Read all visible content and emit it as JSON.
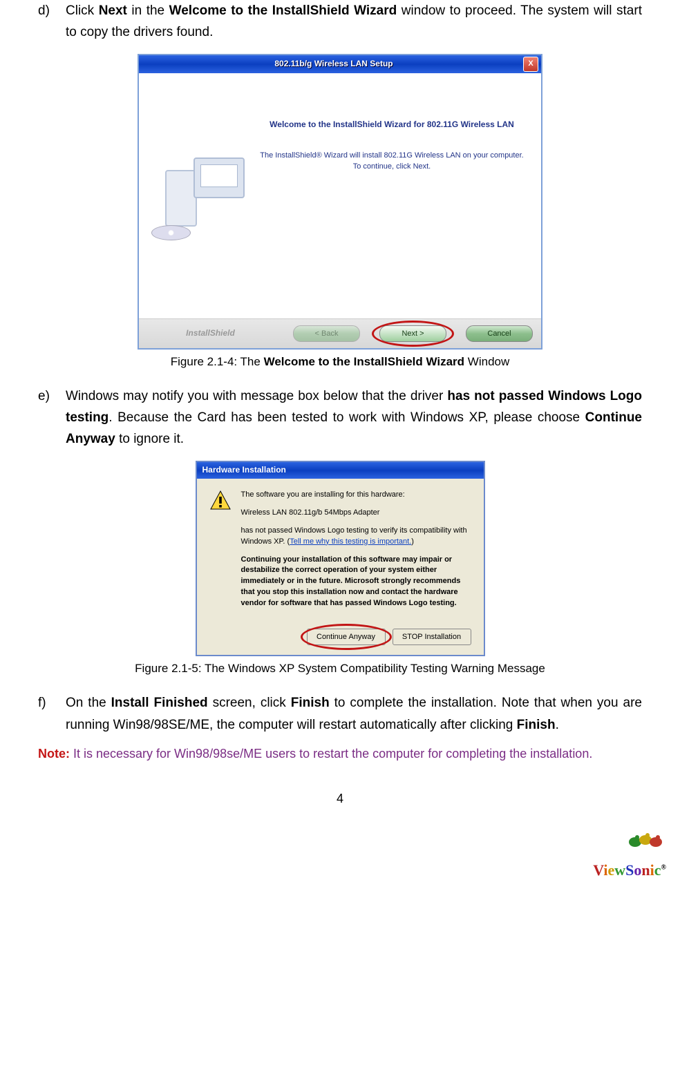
{
  "step_d": {
    "marker": "d)",
    "t1": "Click ",
    "b1": "Next",
    "t2": " in the ",
    "b2": "Welcome to the InstallShield Wizard",
    "t3": " window to proceed. The system will start to copy the drivers found."
  },
  "installer": {
    "title": "802.11b/g Wireless LAN Setup",
    "close": "X",
    "heading": "Welcome to the InstallShield Wizard for 802.11G Wireless LAN",
    "desc": "The InstallShield® Wizard will install 802.11G Wireless LAN on your computer.  To continue, click Next.",
    "brand": "InstallShield",
    "back": "< Back",
    "next": "Next >",
    "cancel": "Cancel"
  },
  "fig1_caption_pre": "Figure 2.1-4: The ",
  "fig1_caption_bold": "Welcome to the InstallShield Wizard",
  "fig1_caption_post": " Window",
  "step_e": {
    "marker": "e)",
    "t1": "Windows may notify you with message box below that the driver ",
    "b1": "has not passed Windows Logo testing",
    "t2": ". Because the Card has been tested to work with Windows XP, please choose ",
    "b2": "Continue Anyway",
    "t3": " to ignore it."
  },
  "hw": {
    "title": "Hardware Installation",
    "line1": "The software you are installing for this hardware:",
    "device": "Wireless LAN 802.11g/b 54Mbps Adapter",
    "line2a": "has not passed Windows Logo testing to verify its compatibility with Windows XP. (",
    "link": "Tell me why this testing is important.",
    "line2b": ")",
    "bold": "Continuing your installation of this software may impair or destabilize the correct operation of your system either immediately or in the future. Microsoft strongly recommends that you stop this installation now and contact the hardware vendor for software that has passed Windows Logo testing.",
    "continue": "Continue Anyway",
    "stop": "STOP Installation"
  },
  "fig2_caption": "Figure 2.1-5: The Windows XP System Compatibility Testing Warning Message",
  "step_f": {
    "marker": "f)",
    "t1": "On the ",
    "b1": "Install Finished",
    "t2": " screen, click ",
    "b2": "Finish",
    "t3": " to complete the installation. Note that when you are running Win98/98SE/ME, the computer will restart automatically after clicking ",
    "b3": "Finish",
    "t4": "."
  },
  "note_label": "Note:",
  "note_body": " It is necessary for Win98/98se/ME users to restart the computer for completing the installation.",
  "page_number": "4",
  "logo_text": "ViewSonic",
  "logo_reg": "®"
}
